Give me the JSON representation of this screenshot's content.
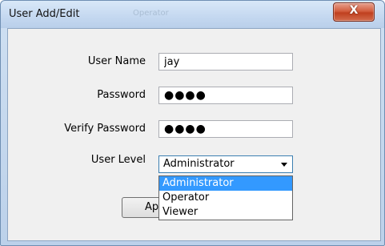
{
  "dialog": {
    "title": "User Add/Edit",
    "background_title": "Operator",
    "close_glyph": "X"
  },
  "form": {
    "username": {
      "label": "User Name",
      "value": "jay"
    },
    "password": {
      "label": "Password",
      "value": "●●●●"
    },
    "verify_password": {
      "label": "Verify Password",
      "value": "●●●●"
    },
    "user_level": {
      "label": "User Level",
      "selected": "Administrator",
      "options": [
        "Administrator",
        "Operator",
        "Viewer"
      ]
    }
  },
  "buttons": {
    "apply_visible_text": "Ap"
  },
  "icons": {
    "close": "close-icon",
    "dropdown": "chevron-down-icon"
  },
  "colors": {
    "selection": "#3399ff",
    "close_button": "#c0401f",
    "titlebar": "#c4d8f0"
  }
}
